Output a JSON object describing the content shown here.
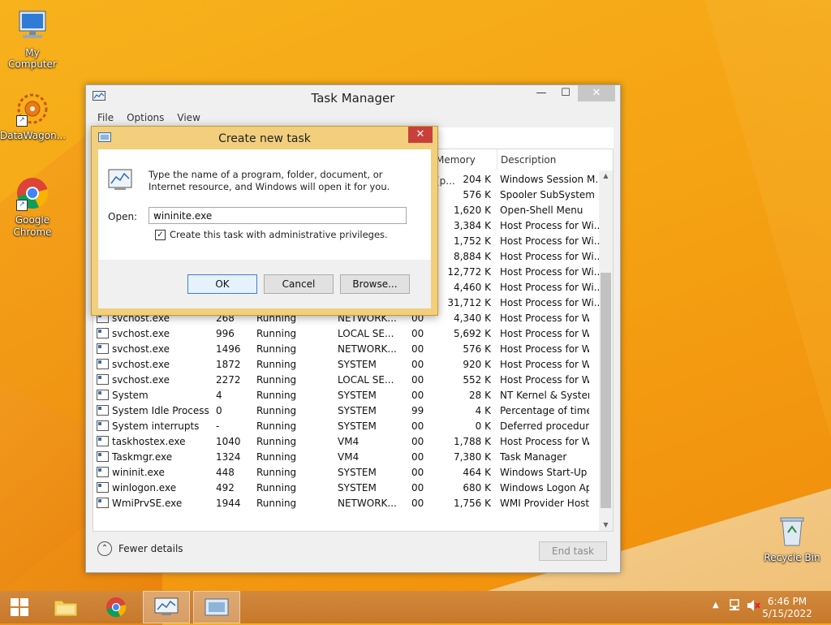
{
  "desktop": {
    "icons": [
      {
        "label": "My Computer"
      },
      {
        "label": "DataWagon..."
      },
      {
        "label": "Google Chrome"
      },
      {
        "label": "Recycle Bin"
      }
    ]
  },
  "task_manager": {
    "title": "Task Manager",
    "menu": [
      "File",
      "Options",
      "View"
    ],
    "columns": {
      "memory": "Memory (p...",
      "description": "Description"
    },
    "top_rows": [
      {
        "memory": "204 K",
        "description": "Windows Session M..."
      },
      {
        "memory": "576 K",
        "description": "Spooler SubSystem ..."
      },
      {
        "memory": "1,620 K",
        "description": "Open-Shell Menu"
      },
      {
        "memory": "3,384 K",
        "description": "Host Process for Wi..."
      },
      {
        "memory": "1,752 K",
        "description": "Host Process for Wi..."
      },
      {
        "memory": "8,884 K",
        "description": "Host Process for Wi..."
      },
      {
        "memory": "12,772 K",
        "description": "Host Process for Wi..."
      },
      {
        "memory": "4,460 K",
        "description": "Host Process for Wi..."
      },
      {
        "memory": "31,712 K",
        "description": "Host Process for Wi..."
      }
    ],
    "rows": [
      {
        "name": "svchost.exe",
        "pid": "268",
        "status": "Running",
        "user": "NETWORK...",
        "cpu": "00",
        "memory": "4,340 K",
        "description": "Host Process for Wi..."
      },
      {
        "name": "svchost.exe",
        "pid": "996",
        "status": "Running",
        "user": "LOCAL SE...",
        "cpu": "00",
        "memory": "5,692 K",
        "description": "Host Process for Wi..."
      },
      {
        "name": "svchost.exe",
        "pid": "1496",
        "status": "Running",
        "user": "NETWORK...",
        "cpu": "00",
        "memory": "576 K",
        "description": "Host Process for Wi..."
      },
      {
        "name": "svchost.exe",
        "pid": "1872",
        "status": "Running",
        "user": "SYSTEM",
        "cpu": "00",
        "memory": "920 K",
        "description": "Host Process for Wi..."
      },
      {
        "name": "svchost.exe",
        "pid": "2272",
        "status": "Running",
        "user": "LOCAL SE...",
        "cpu": "00",
        "memory": "552 K",
        "description": "Host Process for Wi..."
      },
      {
        "name": "System",
        "pid": "4",
        "status": "Running",
        "user": "SYSTEM",
        "cpu": "00",
        "memory": "28 K",
        "description": "NT Kernel & System"
      },
      {
        "name": "System Idle Process",
        "pid": "0",
        "status": "Running",
        "user": "SYSTEM",
        "cpu": "99",
        "memory": "4 K",
        "description": "Percentage of time t..."
      },
      {
        "name": "System interrupts",
        "pid": "-",
        "status": "Running",
        "user": "SYSTEM",
        "cpu": "00",
        "memory": "0 K",
        "description": "Deferred procedure ..."
      },
      {
        "name": "taskhostex.exe",
        "pid": "1040",
        "status": "Running",
        "user": "VM4",
        "cpu": "00",
        "memory": "1,788 K",
        "description": "Host Process for Wi..."
      },
      {
        "name": "Taskmgr.exe",
        "pid": "1324",
        "status": "Running",
        "user": "VM4",
        "cpu": "00",
        "memory": "7,380 K",
        "description": "Task Manager"
      },
      {
        "name": "wininit.exe",
        "pid": "448",
        "status": "Running",
        "user": "SYSTEM",
        "cpu": "00",
        "memory": "464 K",
        "description": "Windows Start-Up A..."
      },
      {
        "name": "winlogon.exe",
        "pid": "492",
        "status": "Running",
        "user": "SYSTEM",
        "cpu": "00",
        "memory": "680 K",
        "description": "Windows Logon Ap..."
      },
      {
        "name": "WmiPrvSE.exe",
        "pid": "1944",
        "status": "Running",
        "user": "NETWORK...",
        "cpu": "00",
        "memory": "1,756 K",
        "description": "WMI Provider Host"
      }
    ],
    "fewer_details": "Fewer details",
    "end_task": "End task"
  },
  "dialog": {
    "title": "Create new task",
    "message": "Type the name of a program, folder, document, or Internet resource, and Windows will open it for you.",
    "open_label": "Open:",
    "open_value": "wininite.exe",
    "admin_checkbox": "Create this task with administrative privileges.",
    "admin_checked": true,
    "ok": "OK",
    "cancel": "Cancel",
    "browse": "Browse..."
  },
  "taskbar": {
    "time": "6:46 PM",
    "date": "5/15/2022"
  }
}
